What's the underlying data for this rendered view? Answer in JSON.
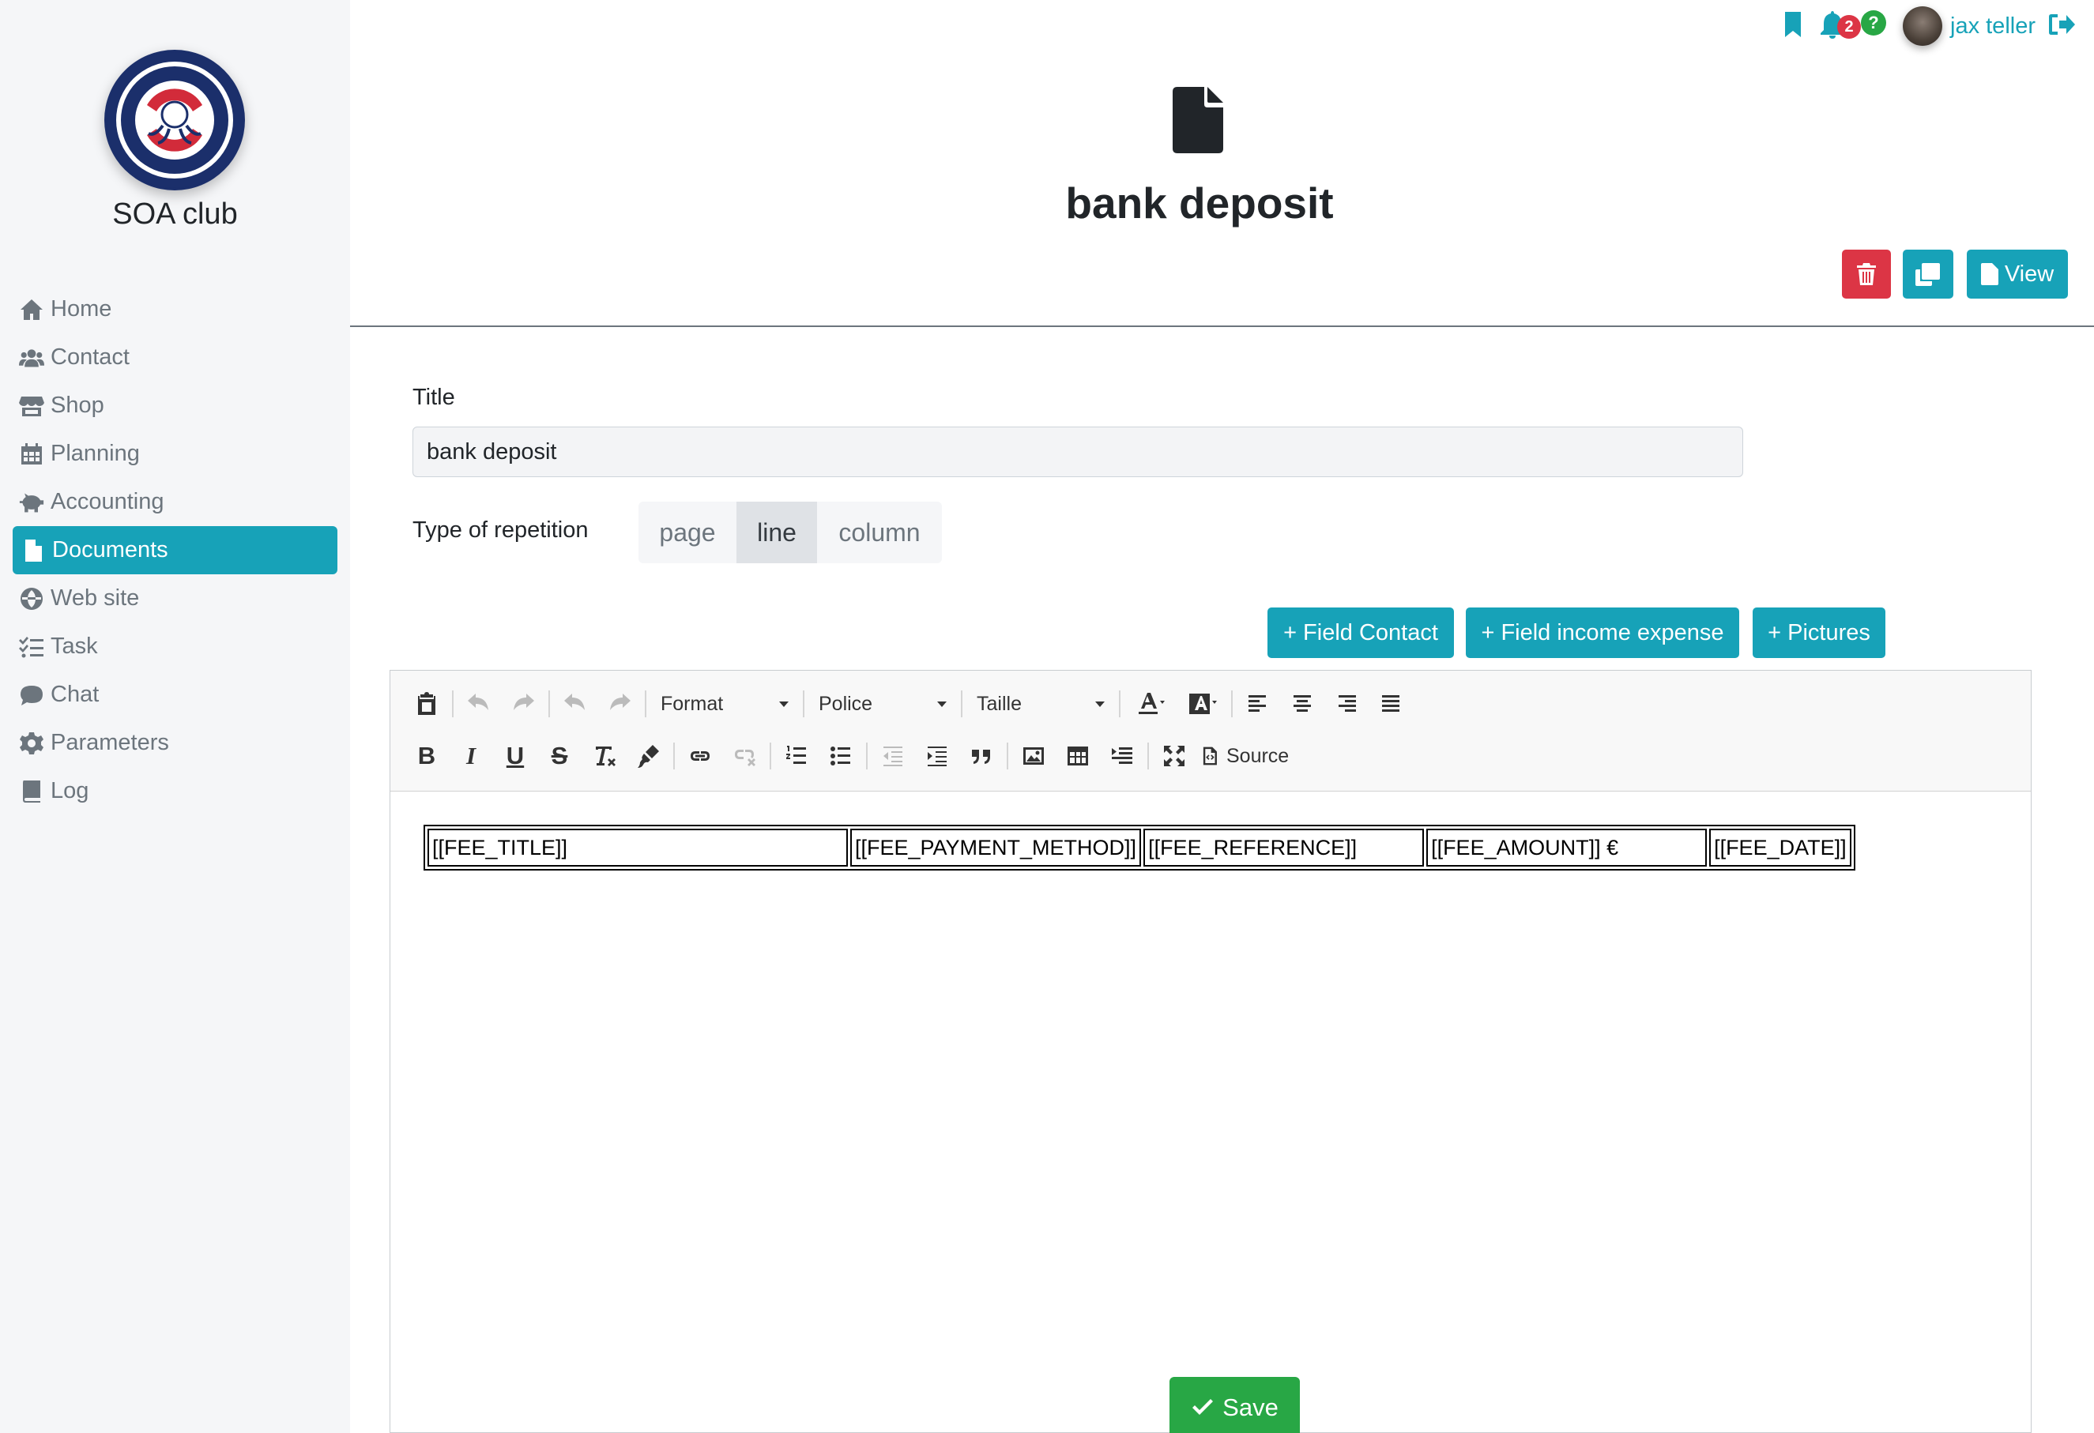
{
  "sidebar": {
    "club_name": "SOA club",
    "items": [
      {
        "label": "Home",
        "icon": "home-icon"
      },
      {
        "label": "Contact",
        "icon": "users-icon"
      },
      {
        "label": "Shop",
        "icon": "store-icon"
      },
      {
        "label": "Planning",
        "icon": "calendar-icon"
      },
      {
        "label": "Accounting",
        "icon": "piggy-bank-icon"
      },
      {
        "label": "Documents",
        "icon": "file-icon",
        "active": true
      },
      {
        "label": "Web site",
        "icon": "globe-icon"
      },
      {
        "label": "Task",
        "icon": "task-list-icon"
      },
      {
        "label": "Chat",
        "icon": "comment-icon"
      },
      {
        "label": "Parameters",
        "icon": "gear-icon"
      },
      {
        "label": "Log",
        "icon": "book-icon"
      }
    ]
  },
  "user_bar": {
    "notification_count": "2",
    "help_badge": "?",
    "username": "jax teller"
  },
  "header": {
    "title": "bank deposit",
    "view_label": "View"
  },
  "form": {
    "title_label": "Title",
    "title_value": "bank deposit",
    "repetition_label": "Type of repetition",
    "repetition_options": [
      "page",
      "line",
      "column"
    ],
    "repetition_selected": "line"
  },
  "field_buttons": {
    "contact": "+ Field Contact",
    "income_expense": "+ Field income expense",
    "pictures": "+ Pictures"
  },
  "editor": {
    "format_label": "Format",
    "font_label": "Police",
    "size_label": "Taille",
    "source_label": "Source",
    "table_cells": [
      "[[FEE_TITLE]]",
      "[[FEE_PAYMENT_METHOD]]",
      "[[FEE_REFERENCE]]",
      "[[FEE_AMOUNT]] €",
      "[[FEE_DATE]]"
    ]
  },
  "save_label": "Save",
  "colors": {
    "accent": "#17a2b8",
    "danger": "#dc3545",
    "success": "#28a745",
    "sidebar_bg": "#f5f6f8"
  }
}
